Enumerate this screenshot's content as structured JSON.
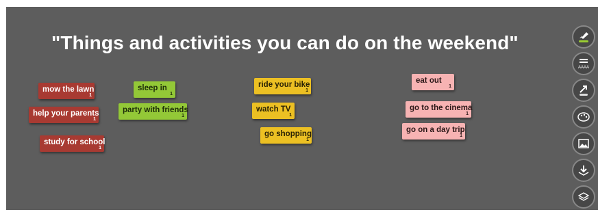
{
  "board": {
    "title": "\"Things and activities you can do on the weekend\""
  },
  "notes": [
    {
      "text": "mow the lawn",
      "count": "1",
      "color": "#a83a32"
    },
    {
      "text": "help your parents",
      "count": "1",
      "color": "#a83a32"
    },
    {
      "text": "study for school",
      "count": "1",
      "color": "#a83a32"
    },
    {
      "text": "sleep in",
      "count": "1",
      "color": "#93c837"
    },
    {
      "text": "party with friends",
      "count": "1",
      "color": "#93c837"
    },
    {
      "text": "ride your bike",
      "count": "1",
      "color": "#ecc023"
    },
    {
      "text": "watch TV",
      "count": "1",
      "color": "#ecc023"
    },
    {
      "text": "go shopping",
      "count": "1",
      "color": "#ecc023"
    },
    {
      "text": "eat out",
      "count": "1",
      "color": "#f7b3b3"
    },
    {
      "text": "go to the cinema",
      "count": "1",
      "color": "#f7b3b3"
    },
    {
      "text": "go on a day trip",
      "count": "1",
      "color": "#f7b3b3"
    }
  ],
  "toolbar": {
    "icons": [
      "rocket-icon",
      "text-size-icon",
      "arrow-icon",
      "palette-icon",
      "image-icon",
      "download-icon",
      "layers-icon"
    ]
  }
}
